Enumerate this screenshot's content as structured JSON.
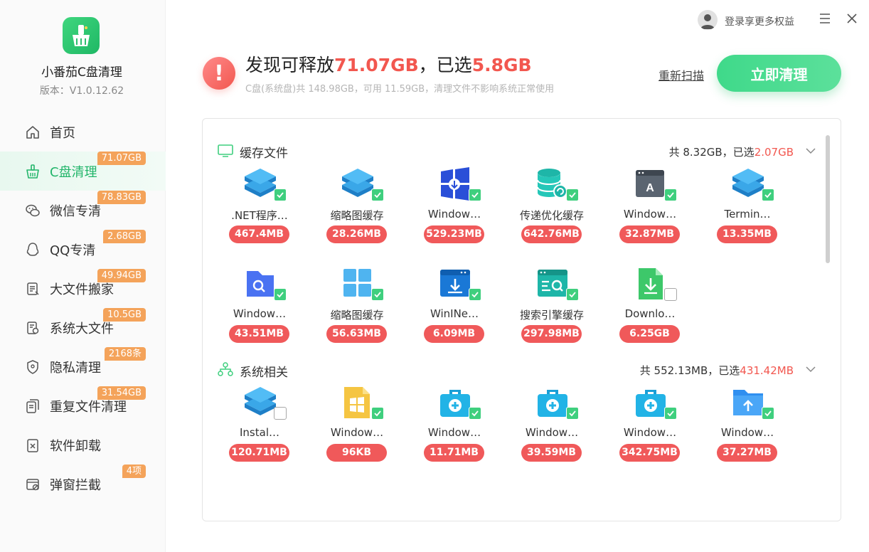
{
  "topbar": {
    "login_text": "登录享更多权益",
    "icons": [
      "user-avatar-icon",
      "menu-icon",
      "close-icon"
    ]
  },
  "sidebar": {
    "app_name": "小番茄C盘清理",
    "version": "版本：V1.0.12.62",
    "items": [
      {
        "label": "首页",
        "badge": "",
        "icon": "home-icon"
      },
      {
        "label": "C盘清理",
        "badge": "71.07GB",
        "icon": "broom-icon",
        "active": true
      },
      {
        "label": "微信专清",
        "badge": "78.83GB",
        "icon": "wechat-icon"
      },
      {
        "label": "QQ专清",
        "badge": "2.68GB",
        "icon": "qq-icon"
      },
      {
        "label": "大文件搬家",
        "badge": "49.94GB",
        "icon": "file-move-icon"
      },
      {
        "label": "系统大文件",
        "badge": "10.5GB",
        "icon": "system-file-icon"
      },
      {
        "label": "隐私清理",
        "badge": "2168条",
        "icon": "shield-icon"
      },
      {
        "label": "重复文件清理",
        "badge": "31.54GB",
        "icon": "duplicate-file-icon"
      },
      {
        "label": "软件卸载",
        "badge": "",
        "icon": "uninstall-icon"
      },
      {
        "label": "弹窗拦截",
        "badge": "4项",
        "icon": "popup-block-icon"
      }
    ]
  },
  "header": {
    "prefix": "发现可释放",
    "total": "71.07GB",
    "middle": "，已选",
    "selected": "5.8GB",
    "subline": "C盘(系统盘)共 148.98GB，可用 11.59GB，清理文件不影响系统正常使用",
    "rescan": "重新扫描",
    "clean_button": "立即清理"
  },
  "sections": [
    {
      "title": "缓存文件",
      "icon": "monitor-icon",
      "summary_prefix": "共 8.32GB，已选",
      "summary_selected": "2.07GB",
      "items": [
        {
          "name": ".NET程序…",
          "size": "467.4MB",
          "icon": "stack-icon",
          "checked": true
        },
        {
          "name": "缩略图缓存",
          "size": "28.26MB",
          "icon": "stack-icon",
          "checked": true
        },
        {
          "name": "Window…",
          "size": "529.23MB",
          "icon": "windows-logo-icon",
          "checked": true
        },
        {
          "name": "传递优化缓存",
          "size": "642.76MB",
          "icon": "database-refresh-icon",
          "checked": true
        },
        {
          "name": "Window…",
          "size": "32.87MB",
          "icon": "font-window-icon",
          "checked": true
        },
        {
          "name": "Termin…",
          "size": "13.35MB",
          "icon": "stack-icon",
          "checked": true
        },
        {
          "name": "Window…",
          "size": "43.51MB",
          "icon": "folder-search-icon",
          "checked": true
        },
        {
          "name": "缩略图缓存",
          "size": "56.63MB",
          "icon": "grid-icon",
          "checked": true
        },
        {
          "name": "WinINe…",
          "size": "6.09MB",
          "icon": "download-window-icon",
          "checked": true
        },
        {
          "name": "搜索引擎缓存",
          "size": "297.98MB",
          "icon": "search-window-icon",
          "checked": true
        },
        {
          "name": "Downlo…",
          "size": "6.25GB",
          "icon": "download-file-icon",
          "checked": false
        }
      ]
    },
    {
      "title": "系统相关",
      "icon": "org-chart-icon",
      "summary_prefix": "共 552.13MB，已选",
      "summary_selected": "431.42MB",
      "items": [
        {
          "name": "Instal…",
          "size": "120.71MB",
          "icon": "stack-icon",
          "checked": false
        },
        {
          "name": "Window…",
          "size": "96KB",
          "icon": "windows-file-icon",
          "checked": true
        },
        {
          "name": "Window…",
          "size": "11.71MB",
          "icon": "medkit-icon",
          "checked": true
        },
        {
          "name": "Window…",
          "size": "39.59MB",
          "icon": "medkit-icon",
          "checked": true
        },
        {
          "name": "Window…",
          "size": "342.75MB",
          "icon": "medkit-icon",
          "checked": true
        },
        {
          "name": "Window…",
          "size": "37.27MB",
          "icon": "upload-folder-icon",
          "checked": true
        }
      ]
    }
  ],
  "colors": {
    "accent_green": "#3fcf7e",
    "badge_orange": "#f4a35a",
    "size_red": "#f0595a",
    "highlight_red": "#f2574f"
  }
}
